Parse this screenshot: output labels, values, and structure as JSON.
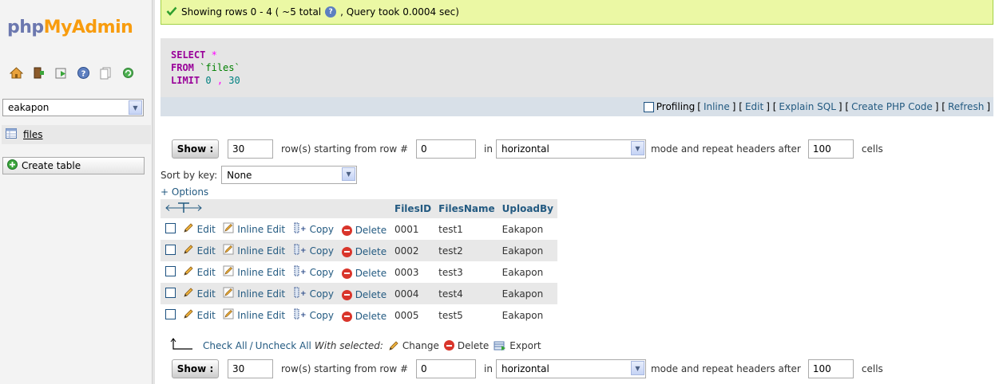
{
  "sidebar": {
    "logo": {
      "php": "php",
      "my": "My",
      "admin": "Admin"
    },
    "nav_icons": [
      "home-icon",
      "logout-icon",
      "query-window-icon",
      "help-icon",
      "docs-icon",
      "reload-icon"
    ],
    "database": "eakapon",
    "tables": [
      {
        "name": "files"
      }
    ],
    "create_table_label": "Create table"
  },
  "message": {
    "text_before": "Showing rows 0 - 4 ( ~5 total",
    "text_after": ", Query took 0.0004 sec)"
  },
  "sql": {
    "line1_kw": "SELECT",
    "line1_rest": "*",
    "line2_kw": "FROM",
    "line2_rest": "`files`",
    "line3_kw": "LIMIT",
    "line3_a": "0",
    "line3_sep": ",",
    "line3_b": "30"
  },
  "sql_links": {
    "profiling": "Profiling",
    "inline": "Inline",
    "edit": "Edit",
    "explain": "Explain SQL",
    "create_php": "Create PHP Code",
    "refresh": "Refresh"
  },
  "nav": {
    "show_label": "Show :",
    "rows_value": "30",
    "starting_text": "row(s) starting from row #",
    "start_value": "0",
    "in_text": "in",
    "mode_value": "horizontal",
    "mode_text": "mode and repeat headers after",
    "repeat_value": "100",
    "cells_text": "cells"
  },
  "sort": {
    "label": "Sort by key:",
    "value": "None"
  },
  "options_label": "+ Options",
  "table": {
    "columns": [
      "FilesID",
      "FilesName",
      "UploadBy"
    ],
    "actions": {
      "edit": "Edit",
      "inline_edit": "Inline Edit",
      "copy": "Copy",
      "delete": "Delete"
    },
    "rows": [
      {
        "id": "0001",
        "name": "test1",
        "by": "Eakapon"
      },
      {
        "id": "0002",
        "name": "test2",
        "by": "Eakapon"
      },
      {
        "id": "0003",
        "name": "test3",
        "by": "Eakapon"
      },
      {
        "id": "0004",
        "name": "test4",
        "by": "Eakapon"
      },
      {
        "id": "0005",
        "name": "test5",
        "by": "Eakapon"
      }
    ]
  },
  "bulk": {
    "check_all": "Check All",
    "separator": "/",
    "uncheck_all": "Uncheck All",
    "with_selected": "With selected:",
    "change": "Change",
    "delete": "Delete",
    "export": "Export"
  },
  "colors": {
    "link": "#235a81",
    "success_bg": "#ebf8a4",
    "keyword": "#990099",
    "delete_red": "#d9352b"
  }
}
